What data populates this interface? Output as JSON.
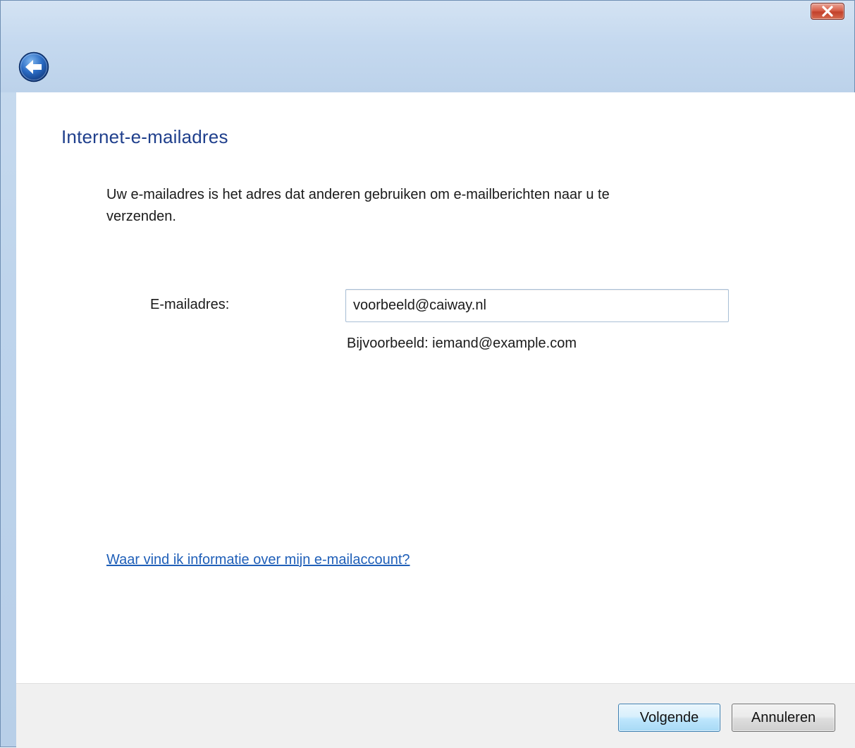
{
  "window": {
    "close_icon": "close-icon",
    "back_icon": "back-arrow-icon"
  },
  "page": {
    "title": "Internet-e-mailadres",
    "description": "Uw e-mailadres is het adres dat anderen gebruiken om e-mailberichten naar u te verzenden."
  },
  "form": {
    "email_label": "E-mailadres:",
    "email_value": "voorbeeld@caiway.nl",
    "example_text": "Bijvoorbeeld: iemand@example.com"
  },
  "help": {
    "link_text": "Waar vind ik informatie over mijn e-mailaccount?"
  },
  "buttons": {
    "next_label": "Volgende",
    "cancel_label": "Annuleren"
  },
  "colors": {
    "title": "#1f3f8c",
    "link": "#1f5fb8",
    "close_button": "#c2412b",
    "chrome": "#c5d9ef"
  }
}
